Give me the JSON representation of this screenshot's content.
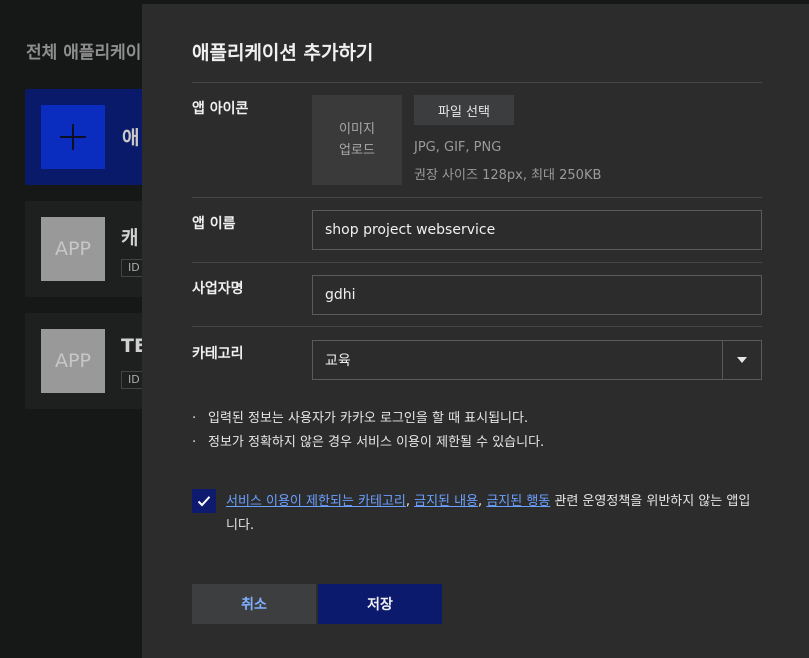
{
  "background": {
    "page_title": "전체 애플리케이",
    "add_card_label": "애",
    "apps": [
      {
        "thumb": "APP",
        "name": "캐",
        "id_badge": "ID"
      },
      {
        "thumb": "APP",
        "name": "TE",
        "id_badge": "ID"
      }
    ]
  },
  "modal": {
    "title": "애플리케이션 추가하기",
    "icon_row": {
      "label": "앱 아이콘",
      "upload_line1": "이미지",
      "upload_line2": "업로드",
      "file_button": "파일 선택",
      "hint_formats": "JPG, GIF, PNG",
      "hint_size": "권장 사이즈 128px, 최대 250KB"
    },
    "name_row": {
      "label": "앱 이름",
      "value": "shop project webservice"
    },
    "company_row": {
      "label": "사업자명",
      "value": "gdhi"
    },
    "category_row": {
      "label": "카테고리",
      "selected": "교육"
    },
    "notes": [
      "입력된 정보는 사용자가 카카오 로그인을 할 때 표시됩니다.",
      "정보가 정확하지 않은 경우 서비스 이용이 제한될 수 있습니다."
    ],
    "agreement": {
      "checked": true,
      "link1": "서비스 이용이 제한되는 카테고리",
      "sep1": ", ",
      "link2": "금지된 내용",
      "sep2": ", ",
      "link3": "금지된 행동",
      "rest": " 관련 운영정책을 위반하지 않는 앱입니다."
    },
    "buttons": {
      "cancel": "취소",
      "save": "저장"
    }
  },
  "colors": {
    "accent": "#0c1a6e",
    "link": "#6aa0ff",
    "modal_bg": "#2c2c2c"
  }
}
